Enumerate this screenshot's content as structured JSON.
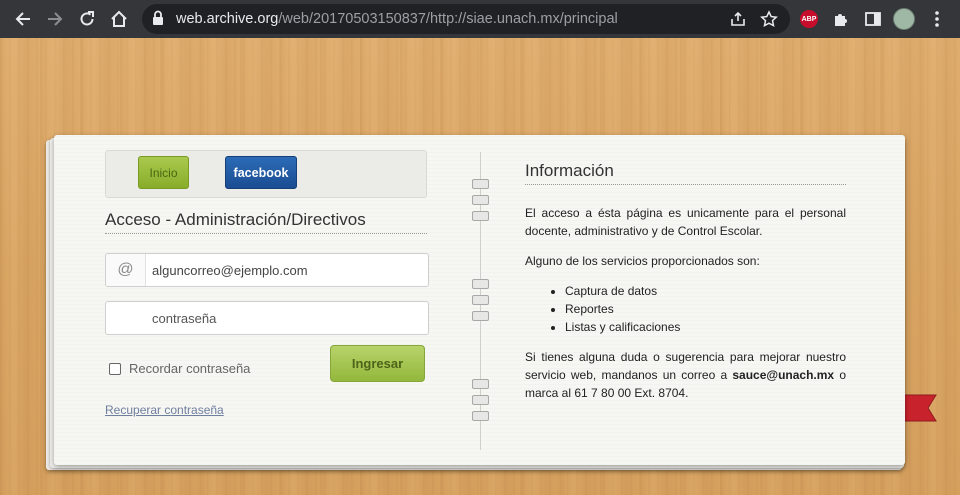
{
  "browser": {
    "url_host": "web.archive.org",
    "url_path": "/web/20170503150837/http://siae.unach.mx/principal",
    "extension_label": "ABP"
  },
  "nav": {
    "inicio_label": "Inicio",
    "facebook_label": "facebook"
  },
  "login": {
    "title": "Acceso - Administración/Directivos",
    "email_prefix": "@",
    "email_value": "alguncorreo@ejemplo.com",
    "password_value": "contraseña",
    "remember_label": "Recordar contraseña",
    "submit_label": "Ingresar",
    "recover_label": "Recuperar contraseña"
  },
  "info": {
    "title": "Información",
    "p1": "El acceso a ésta página es unicamente para el personal docente, administrativo y de Control Escolar.",
    "p2": "Alguno de los servicios proporcionados son:",
    "services": [
      "Captura de datos",
      "Reportes",
      "Listas y calificaciones"
    ],
    "p3_before": "Si tienes alguna duda o sugerencia para mejorar nuestro servicio web, mandanos un correo a ",
    "p3_email": "sauce@unach.mx",
    "p3_after": " o marca al 61 7 80 00 Ext. 8704."
  },
  "colors": {
    "chrome": "#35363a",
    "wood": "#d9a868",
    "inicio_green": "#88ad2a",
    "facebook_blue": "#1a4d92",
    "ribbon_red": "#c8232c"
  }
}
